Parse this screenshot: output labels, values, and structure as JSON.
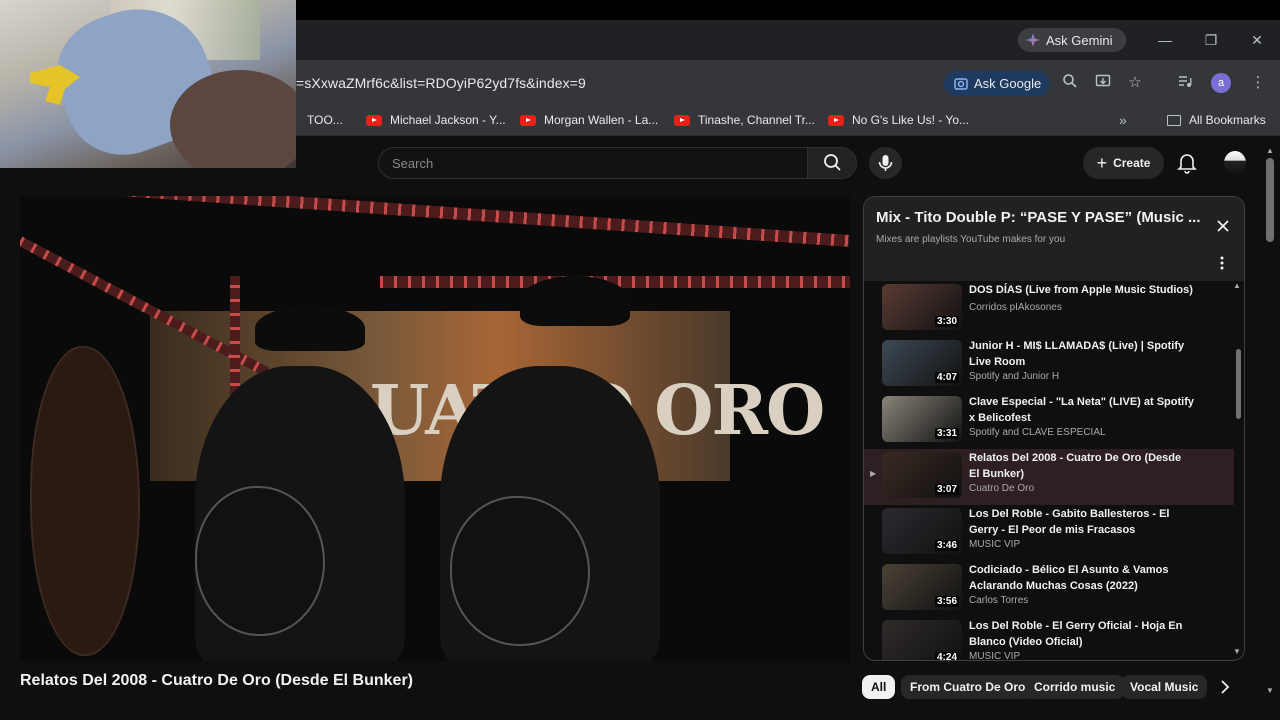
{
  "browser": {
    "gemini_label": "Ask Gemini",
    "url": "=sXxwaZMrf6c&list=RDOyiP62yd7fs&index=9",
    "ask_google_label": "Ask Google",
    "profile_initial": "a",
    "bookmarks": [
      {
        "label": "TOO..."
      },
      {
        "label": "Michael Jackson - Y..."
      },
      {
        "label": "Morgan Wallen - La..."
      },
      {
        "label": "Tinashe, Channel Tr..."
      },
      {
        "label": "No G's Like Us! - Yo..."
      }
    ],
    "all_bookmarks_label": "All Bookmarks"
  },
  "youtube": {
    "search_placeholder": "Search",
    "create_label": "Create",
    "video_title": "Relatos Del 2008 - Cuatro De Oro (Desde El Bunker)",
    "video_banner_text": "UATRO ORO"
  },
  "playlist": {
    "title": "Mix - Tito Double P: “PASE Y PASE” (Music ...",
    "subtitle": "Mixes are playlists YouTube makes for you",
    "items": [
      {
        "title": "DOS DÍAS (Live from Apple Music Studios)",
        "channel": "Corridos pIAkosones",
        "duration": "3:30",
        "active": false,
        "thumb_color": "#5a3b34"
      },
      {
        "title": "Junior H - MI$ LLAMADA$ (Live) | Spotify Live Room",
        "channel": "Spotify and Junior H",
        "duration": "4:07",
        "active": false,
        "thumb_color": "#3d4a55"
      },
      {
        "title": "Clave Especial - \"La Neta\" (LIVE) at Spotify x Belicofest",
        "channel": "Spotify and CLAVE ESPECIAL",
        "duration": "3:31",
        "active": false,
        "thumb_color": "#8a8479"
      },
      {
        "title": "Relatos Del 2008 - Cuatro De Oro (Desde El Bunker)",
        "channel": "Cuatro De Oro",
        "duration": "3:07",
        "active": true,
        "thumb_color": "#3a2a22"
      },
      {
        "title": "Los Del Roble - Gabito Ballesteros - El Gerry - El Peor de mis Fracasos",
        "channel": "MUSIC VIP",
        "duration": "3:46",
        "active": false,
        "thumb_color": "#2c2a30"
      },
      {
        "title": "Codiciado - Bélico El Asunto & Vamos Aclarando Muchas Cosas (2022)",
        "channel": "Carlos Torres",
        "duration": "3:56",
        "active": false,
        "thumb_color": "#4a4236"
      },
      {
        "title": "Los Del Roble - El Gerry Oficial - Hoja En Blanco (Video Oficial)",
        "channel": "MUSIC VIP",
        "duration": "4:24",
        "active": false,
        "thumb_color": "#2f2b2a"
      }
    ]
  },
  "chips": [
    "All",
    "From Cuatro De Oro",
    "Corrido music",
    "Vocal Music"
  ]
}
